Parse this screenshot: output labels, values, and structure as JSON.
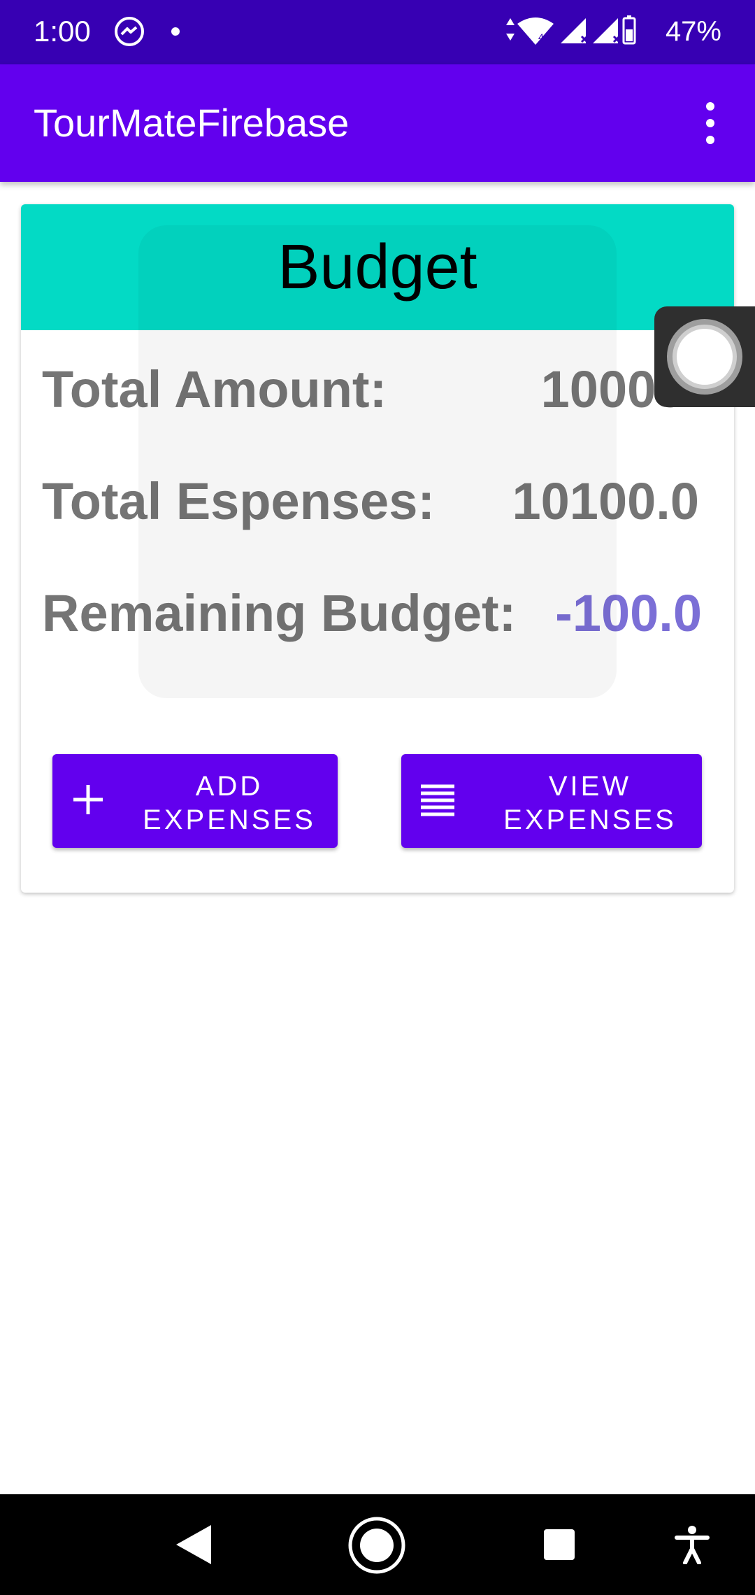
{
  "status_bar": {
    "time": "1:00",
    "battery_percent": "47%",
    "icons": [
      "messenger-icon",
      "notification-dot-icon",
      "data-arrows-icon",
      "wifi-icon",
      "signal-icon",
      "signal-icon",
      "battery-icon"
    ]
  },
  "app_bar": {
    "title": "TourMateFirebase",
    "overflow_icon": "more-vert-icon"
  },
  "budget_card": {
    "header": "Budget",
    "rows": [
      {
        "label": "Total Amount:",
        "value": "10000."
      },
      {
        "label": "Total Espenses:",
        "value": "10100.0"
      },
      {
        "label": "Remaining Budget:",
        "value": "-100.0"
      }
    ]
  },
  "buttons": {
    "add_expenses": {
      "line1": "ADD",
      "line2": "EXPENSES",
      "icon": "plus-icon"
    },
    "view_expenses": {
      "line1": "VIEW",
      "line2": "EXPENSES",
      "icon": "list-icon"
    }
  },
  "colors": {
    "status_bar": "#3700b3",
    "primary": "#6200ee",
    "accent": "#03dac5",
    "negative_value": "#7b6fd6",
    "text_gray": "#757575"
  },
  "nav_bar": {
    "icons": [
      "back-icon",
      "home-icon",
      "recents-icon",
      "accessibility-icon"
    ]
  }
}
